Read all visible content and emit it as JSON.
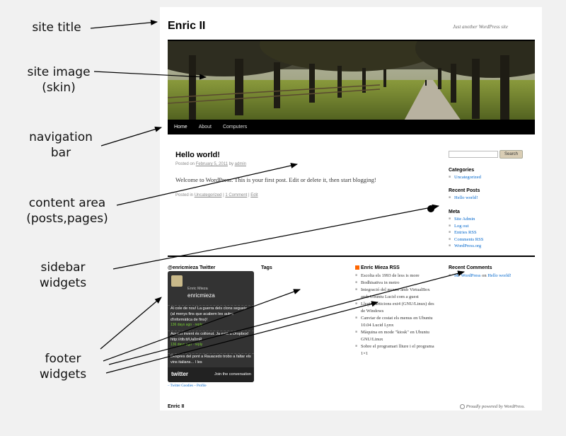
{
  "annotations": {
    "site_title": "site title",
    "site_image_1": "site image",
    "site_image_2": "(skin)",
    "navigation_1": "navigation",
    "navigation_2": "bar",
    "content_1": "content area",
    "content_2": "(posts,pages)",
    "sidebar_1": "sidebar",
    "sidebar_2": "widgets",
    "footer_1": "footer",
    "footer_2": "widgets"
  },
  "site": {
    "title": "Enric II",
    "tagline": "Just another WordPress site"
  },
  "nav": {
    "items": [
      "Home",
      "About",
      "Computers"
    ]
  },
  "post": {
    "title": "Hello world!",
    "meta_prefix": "Posted on",
    "date": "February 5, 2011",
    "by": "by",
    "author": "admin",
    "body": "Welcome to WordPress. This is your first post. Edit or delete it, then start blogging!",
    "posted_in": "Posted in",
    "category": "Uncategorized",
    "sep1": "|",
    "comments": "1 Comment",
    "sep2": "|",
    "edit": "Edit"
  },
  "sidebar": {
    "search_button": "Search",
    "categories_title": "Categories",
    "categories": [
      "Uncategorized"
    ],
    "recent_posts_title": "Recent Posts",
    "recent_posts": [
      "Hello world!"
    ],
    "meta_title": "Meta",
    "meta": [
      "Site Admin",
      "Log out",
      "Entries RSS",
      "Comments RSS",
      "WordPress.org"
    ]
  },
  "footer_widgets": {
    "twitter_title": "@enricmieza Twitter",
    "twitter_name": "Enric Mieza",
    "twitter_user": "enricmieza",
    "tweets": [
      {
        "text": "Al cole de nou! La guerra dels clons segueix (al menys fins que acabem les aules d'informàtica de fins)!",
        "time": "136 days ago · reply"
      },
      {
        "text": "Aquest invent és collonut. Ja està a Dropbox! http://db.tt/Ua0mR",
        "time": "136 days ago · reply"
      },
      {
        "text": "Despres del pont a Rauacedo trobo a faltar els vins italians... I les",
        "time": ""
      }
    ],
    "twitter_logo": "twitter",
    "twitter_join": "Join the conversation",
    "twitter_goodies": "– Twitter Goodies – Profile",
    "tags_title": "Tags",
    "rss_title": "Enric Mieza RSS",
    "rss_items": [
      "Escolta els 1993 de less is more",
      "Bodhisattva in metro",
      "Integració del mouse amb VirtualBox amb Ubuntu Lucid com a guest",
      "Llegir particions ext4 (GNU/Linux) des de Windows",
      "Canviar de costat els menus en Ubuntu 10.04 Lucid Lynx",
      "Màquina en mode \"kiosk\" en Ubuntu GNU/Linux",
      "Sobre el programari lliure i el programa 1×1"
    ],
    "recent_comments_title": "Recent Comments",
    "recent_comment_author": "Mr WordPress",
    "recent_comment_on": "on",
    "recent_comment_post": "Hello world!"
  },
  "footer": {
    "title": "Enric II",
    "powered": "Proudly powered by WordPress."
  }
}
